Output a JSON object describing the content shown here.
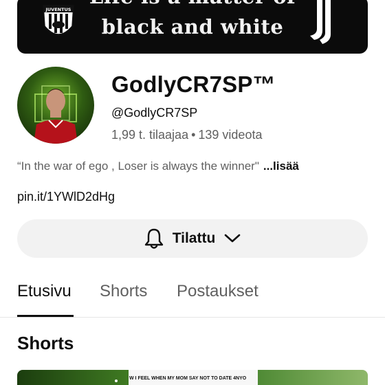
{
  "banner": {
    "line1": "Life is a matter of",
    "line2": "black and white",
    "badge_text": "JUVENTUS"
  },
  "channel": {
    "name": "GodlyCR7SP™",
    "handle": "@GodlyCR7SP",
    "subscribers": "1,99 t. tilaajaa",
    "separator": "•",
    "videos": "139 videota",
    "description": "“In the war of ego , Loser is always the winner\"",
    "more_label": "...lisää",
    "link": "pin.it/1YWlD2dHg"
  },
  "subscribe": {
    "label": "Tilattu",
    "icon": "bell-icon",
    "dropdown_icon": "chevron-down-icon"
  },
  "tabs": [
    {
      "label": "Etusivu",
      "active": true
    },
    {
      "label": "Shorts",
      "active": false
    },
    {
      "label": "Postaukset",
      "active": false
    }
  ],
  "section": {
    "title": "Shorts"
  },
  "shorts": [
    {
      "caption": ""
    },
    {
      "caption": "W I FEEL WHEN MY MOM SAY NOT TO DATE 4NYO"
    },
    {
      "caption": ""
    }
  ],
  "colors": {
    "text_primary": "#0f0f0f",
    "text_secondary": "#606060",
    "button_bg": "#f2f2f2",
    "banner_bg": "#0b0b0b"
  }
}
